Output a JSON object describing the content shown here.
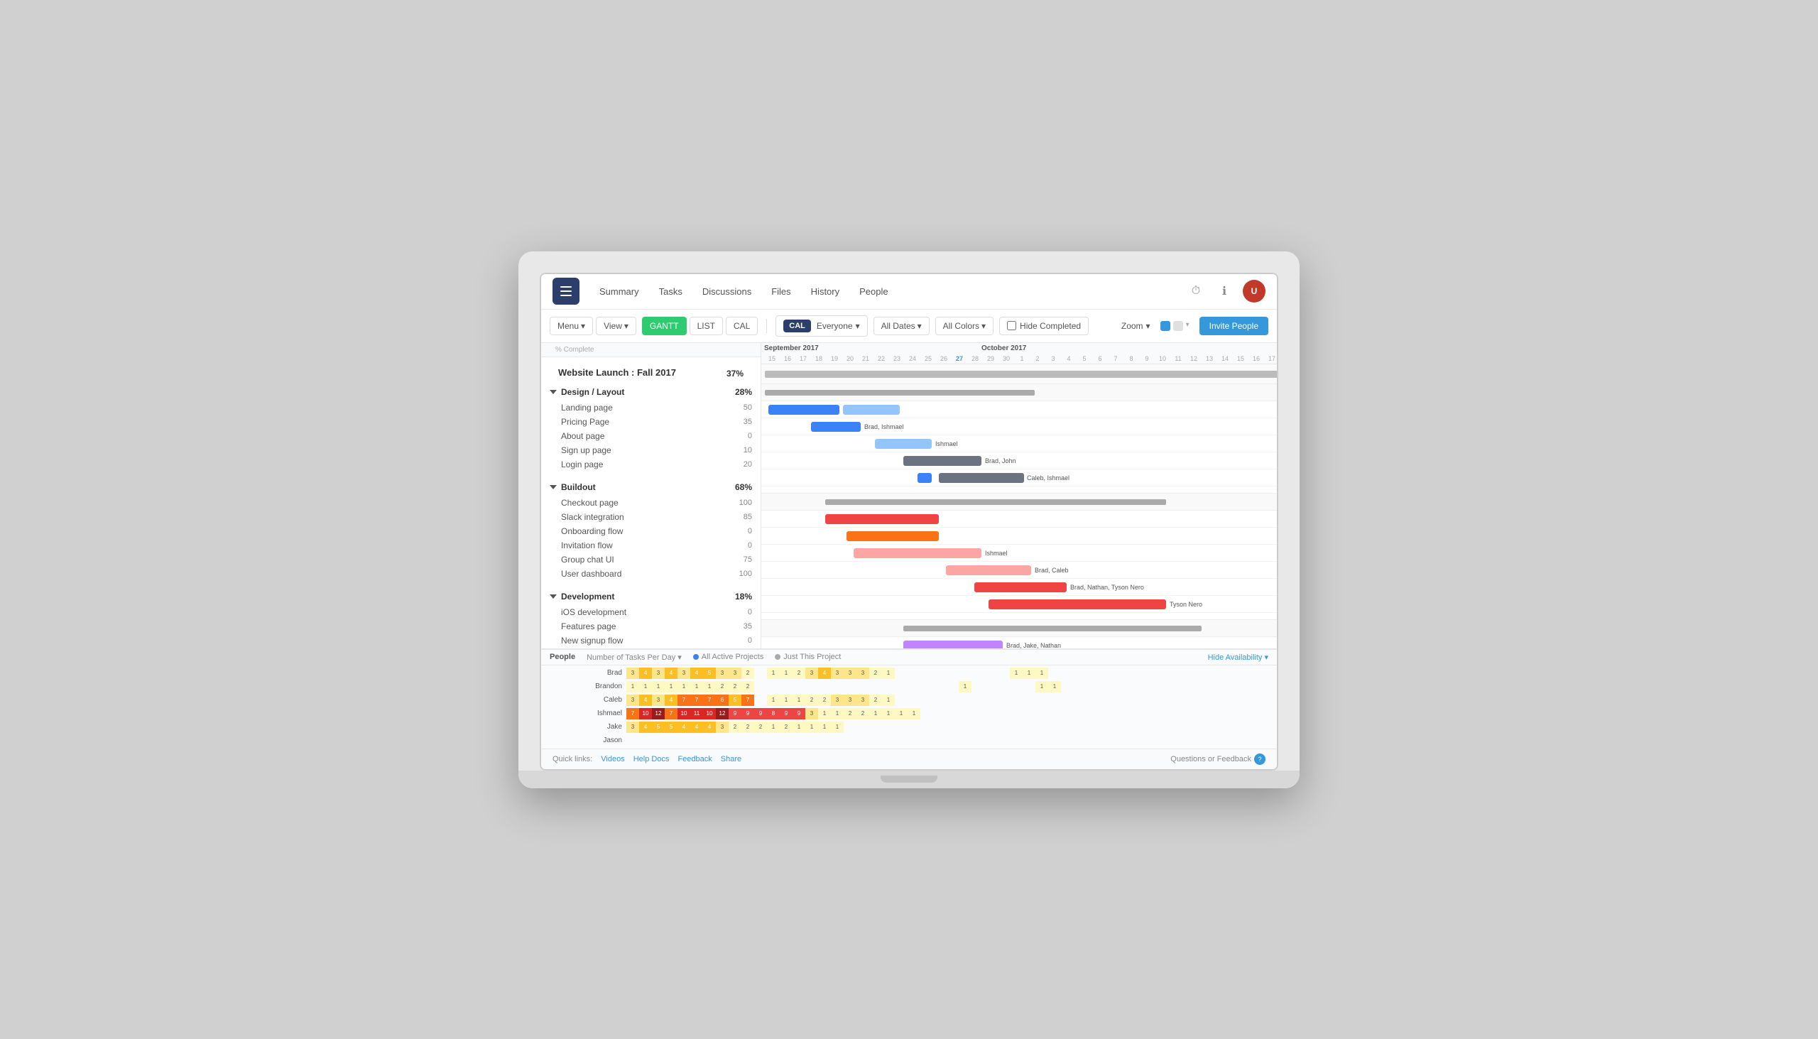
{
  "app": {
    "title": "Website Launch : Fall 2017",
    "hamburger_aria": "menu"
  },
  "nav": {
    "tabs": [
      {
        "label": "Summary",
        "active": false
      },
      {
        "label": "Tasks",
        "active": false
      },
      {
        "label": "Discussions",
        "active": false
      },
      {
        "label": "Files",
        "active": false
      },
      {
        "label": "History",
        "active": false
      },
      {
        "label": "People",
        "active": false
      }
    ]
  },
  "toolbar": {
    "menu_label": "Menu",
    "view_label": "View",
    "gantt_label": "GANTT",
    "list_label": "LIST",
    "cal_label": "CAL",
    "everyone_label": "Everyone",
    "all_dates_label": "All Dates",
    "all_colors_label": "All Colors",
    "hide_completed_label": "Hide Completed",
    "zoom_label": "Zoom",
    "invite_label": "Invite People"
  },
  "project": {
    "title": "Website Launch : Fall 2017",
    "pct": "37%",
    "groups": [
      {
        "name": "Design / Layout",
        "pct": "28%",
        "tasks": [
          {
            "name": "Landing page",
            "pct": "50"
          },
          {
            "name": "Pricing Page",
            "pct": "35"
          },
          {
            "name": "About page",
            "pct": "0"
          },
          {
            "name": "Sign up page",
            "pct": "10"
          },
          {
            "name": "Login page",
            "pct": "20"
          }
        ]
      },
      {
        "name": "Buildout",
        "pct": "68%",
        "tasks": [
          {
            "name": "Checkout page",
            "pct": "100"
          },
          {
            "name": "Slack integration",
            "pct": "85"
          },
          {
            "name": "Onboarding flow",
            "pct": "0"
          },
          {
            "name": "Invitation flow",
            "pct": "0"
          },
          {
            "name": "Group chat UI",
            "pct": "75"
          },
          {
            "name": "User dashboard",
            "pct": "100"
          }
        ]
      },
      {
        "name": "Development",
        "pct": "18%",
        "tasks": [
          {
            "name": "iOS development",
            "pct": "0"
          },
          {
            "name": "Features page",
            "pct": "35"
          },
          {
            "name": "New signup flow",
            "pct": "0"
          }
        ]
      }
    ]
  },
  "gantt": {
    "months": [
      "September 2017",
      "October 2017"
    ],
    "sep_label": "September 2017",
    "oct_label": "October 2017"
  },
  "bottom": {
    "people_label": "People",
    "tasks_per_day_label": "Number of Tasks Per Day",
    "all_projects_label": "All Active Projects",
    "just_project_label": "Just This Project",
    "hide_availability_label": "Hide Availability"
  },
  "footer": {
    "quick_links": "Quick links:",
    "videos": "Videos",
    "help_docs": "Help Docs",
    "feedback": "Feedback",
    "share": "Share",
    "questions": "Questions or Feedback",
    "badge": "?"
  }
}
